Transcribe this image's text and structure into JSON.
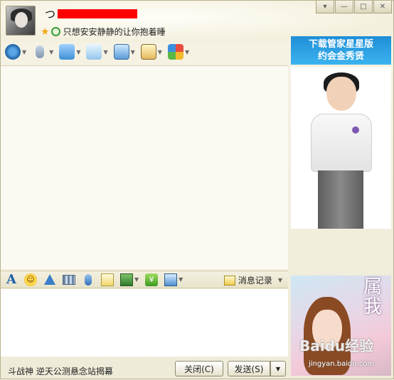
{
  "header": {
    "nickname": "つ",
    "signature": "只想安安静静的让你抱着睡"
  },
  "window_buttons": [
    "▾",
    "—",
    "□",
    "✕"
  ],
  "ad_top": {
    "line1": "下载管家星星版",
    "line2": "约会金秀贤"
  },
  "toolbar": {
    "icons": [
      "video-call",
      "voice-call",
      "file-transfer",
      "send-message",
      "remote-assist",
      "share-screen",
      "apps"
    ]
  },
  "input_toolbar": {
    "font_glyph": "A",
    "smiley_glyph": "☺",
    "history_label": "消息记录"
  },
  "status_bar": {
    "text": "斗战神 逆天公测悬念站揭幕"
  },
  "buttons": {
    "close_label": "关闭(C)",
    "send_label": "发送(S)",
    "send_dropdown": "▼"
  },
  "promo": {
    "title": "属我",
    "watermark": "Baidu经验",
    "watermark_url": "jingyan.baidu.com"
  },
  "colors": {
    "window_bg": "#f3f0e2",
    "ad_blue": "#1f8ed6",
    "redaction": "#ff0000"
  }
}
